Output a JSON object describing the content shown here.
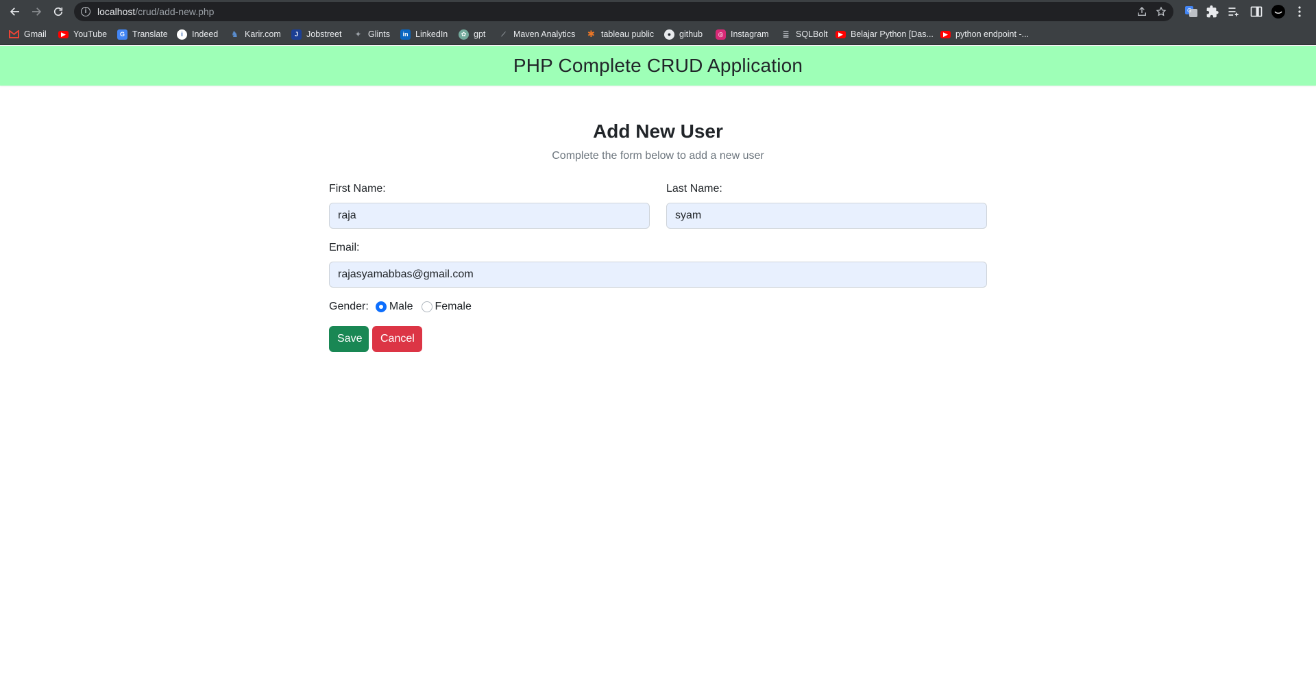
{
  "browser": {
    "url_host": "localhost",
    "url_path": "/crud/add-new.php",
    "bookmarks": [
      {
        "label": "Gmail",
        "icon": "gmail-icon",
        "color": "#ea4335"
      },
      {
        "label": "YouTube",
        "icon": "youtube-icon",
        "color": "#ff0000"
      },
      {
        "label": "Translate",
        "icon": "translate-icon",
        "color": "#4285f4"
      },
      {
        "label": "Indeed",
        "icon": "indeed-icon",
        "color": "#ffffff"
      },
      {
        "label": "Karir.com",
        "icon": "karir-icon",
        "color": "#5b8fd1"
      },
      {
        "label": "Jobstreet",
        "icon": "jobstreet-icon",
        "color": "#1c3f94"
      },
      {
        "label": "Glints",
        "icon": "glints-icon",
        "color": "#9aa0a6"
      },
      {
        "label": "LinkedIn",
        "icon": "linkedin-icon",
        "color": "#0a66c2"
      },
      {
        "label": "gpt",
        "icon": "chatgpt-icon",
        "color": "#74aa9c"
      },
      {
        "label": "Maven Analytics",
        "icon": "maven-icon",
        "color": "#5f6368"
      },
      {
        "label": "tableau public",
        "icon": "tableau-icon",
        "color": "#e97627"
      },
      {
        "label": "github",
        "icon": "github-icon",
        "color": "#e8eaed"
      },
      {
        "label": "Instagram",
        "icon": "instagram-icon",
        "color": "#d62976"
      },
      {
        "label": "SQLBolt",
        "icon": "sqlbolt-icon",
        "color": "#bdc1c6"
      },
      {
        "label": "Belajar Python [Das...",
        "icon": "youtube-icon",
        "color": "#ff0000"
      },
      {
        "label": "python endpoint -...",
        "icon": "youtube-icon",
        "color": "#ff0000"
      }
    ]
  },
  "header": {
    "title": "PHP Complete CRUD Application",
    "bg_color": "#9effb7"
  },
  "form": {
    "title": "Add New User",
    "subtitle": "Complete the form below to add a new user",
    "first_name_label": "First Name:",
    "first_name_value": "raja",
    "last_name_label": "Last Name:",
    "last_name_value": "syam",
    "email_label": "Email:",
    "email_value": "rajasyamabbas@gmail.com",
    "gender_label": "Gender:",
    "gender_options": [
      "Male",
      "Female"
    ],
    "gender_selected": "Male",
    "save_label": "Save",
    "cancel_label": "Cancel",
    "save_color": "#198754",
    "cancel_color": "#dc3545"
  }
}
